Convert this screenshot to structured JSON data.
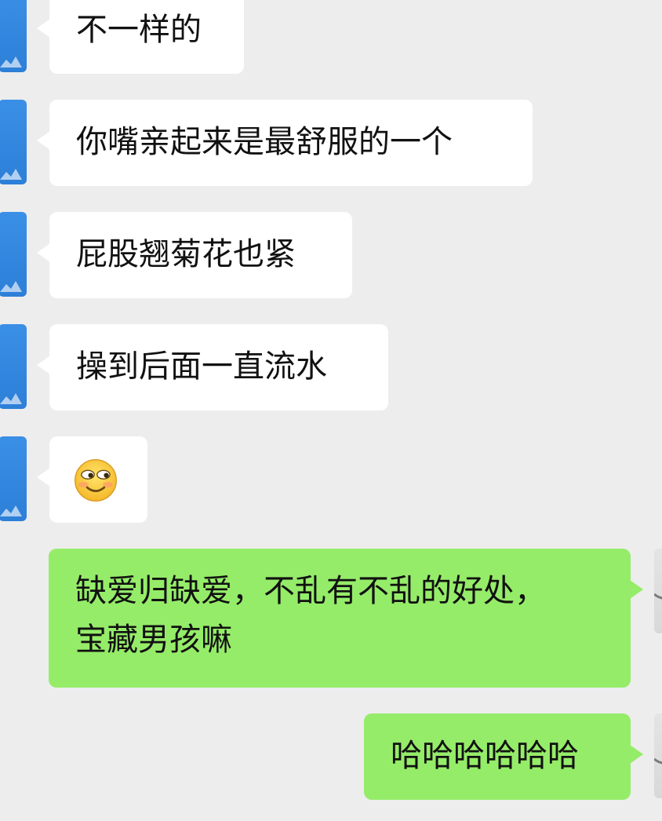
{
  "messages": [
    {
      "side": "in",
      "text": "不一样的"
    },
    {
      "side": "in",
      "text": "你嘴亲起来是最舒服的一个"
    },
    {
      "side": "in",
      "text": "屁股翘菊花也紧"
    },
    {
      "side": "in",
      "text": "操到后面一直流水"
    },
    {
      "side": "in",
      "type": "emoji",
      "emoji_name": "smirk-emoji"
    },
    {
      "side": "out",
      "text_line1": "缺爱归缺爱，不乱有不乱的好处，",
      "text_line2": "宝藏男孩嘛"
    },
    {
      "side": "out",
      "text": "哈哈哈哈哈哈"
    }
  ],
  "colors": {
    "background": "#ededed",
    "incoming_bubble": "#ffffff",
    "outgoing_bubble": "#95ec69",
    "contact_avatar": "#2d7fd8",
    "self_avatar": "#dcdcdc"
  }
}
